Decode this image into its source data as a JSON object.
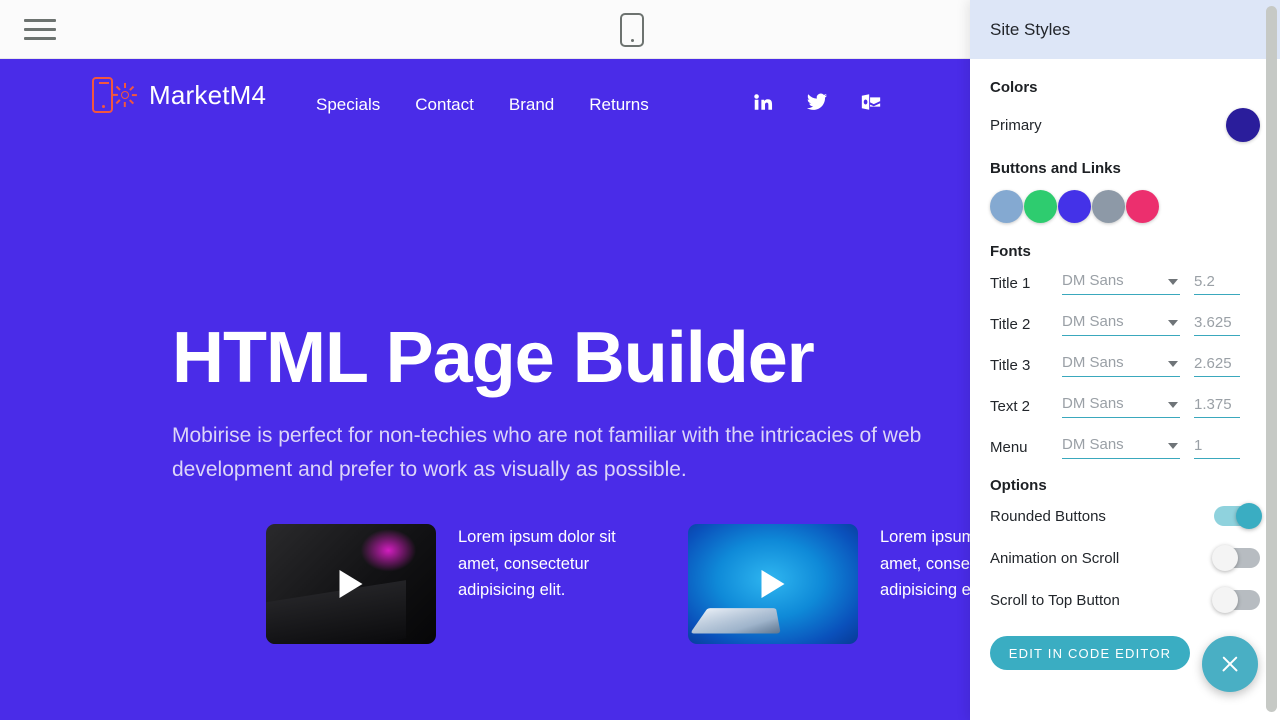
{
  "toolbar": {
    "menu_icon": "hamburger-menu-icon",
    "device_icon": "mobile-device-preview-icon"
  },
  "site": {
    "brand_name": "MarketM4",
    "logo_icon": "phone-sun-logo-icon",
    "nav": [
      {
        "label": "Specials"
      },
      {
        "label": "Contact"
      },
      {
        "label": "Brand"
      },
      {
        "label": "Returns"
      }
    ],
    "socials": [
      {
        "name": "linkedin-icon"
      },
      {
        "name": "twitter-icon"
      },
      {
        "name": "outlook-mail-icon"
      }
    ],
    "hero": {
      "title": "HTML Page Builder",
      "subtitle": "Mobirise is perfect for non-techies who are not familiar with the intricacies of web development and prefer to work as visually as possible."
    },
    "cards": [
      {
        "text": "Lorem ipsum dolor sit amet, consectetur adipisicing elit.",
        "thumb": "dark-laptop-video-thumbnail"
      },
      {
        "text": "Lorem ipsum dolor sit amet, consectetur adipisicing elit.",
        "thumb": "blue-laptop-video-thumbnail"
      }
    ]
  },
  "panel": {
    "title": "Site Styles",
    "colors": {
      "heading": "Colors",
      "primary_label": "Primary",
      "primary_color": "#2a1d9b",
      "buttons_label": "Buttons and Links",
      "button_colors": [
        "#84a9d1",
        "#2ecc6f",
        "#4432e8",
        "#8d99a7",
        "#ec2f6e"
      ]
    },
    "fonts": {
      "heading": "Fonts",
      "rows": [
        {
          "label": "Title 1",
          "family": "DM Sans",
          "size": "5.2"
        },
        {
          "label": "Title 2",
          "family": "DM Sans",
          "size": "3.625"
        },
        {
          "label": "Title 3",
          "family": "DM Sans",
          "size": "2.625"
        },
        {
          "label": "Text 2",
          "family": "DM Sans",
          "size": "1.375"
        },
        {
          "label": "Menu",
          "family": "DM Sans",
          "size": "1"
        }
      ]
    },
    "options": {
      "heading": "Options",
      "rows": [
        {
          "label": "Rounded Buttons",
          "state": "on"
        },
        {
          "label": "Animation on Scroll",
          "state": "off"
        },
        {
          "label": "Scroll to Top Button",
          "state": "off"
        }
      ],
      "code_button": "EDIT IN CODE EDITOR"
    },
    "close_icon": "close-x-icon",
    "accent_color": "#3aadc2"
  }
}
